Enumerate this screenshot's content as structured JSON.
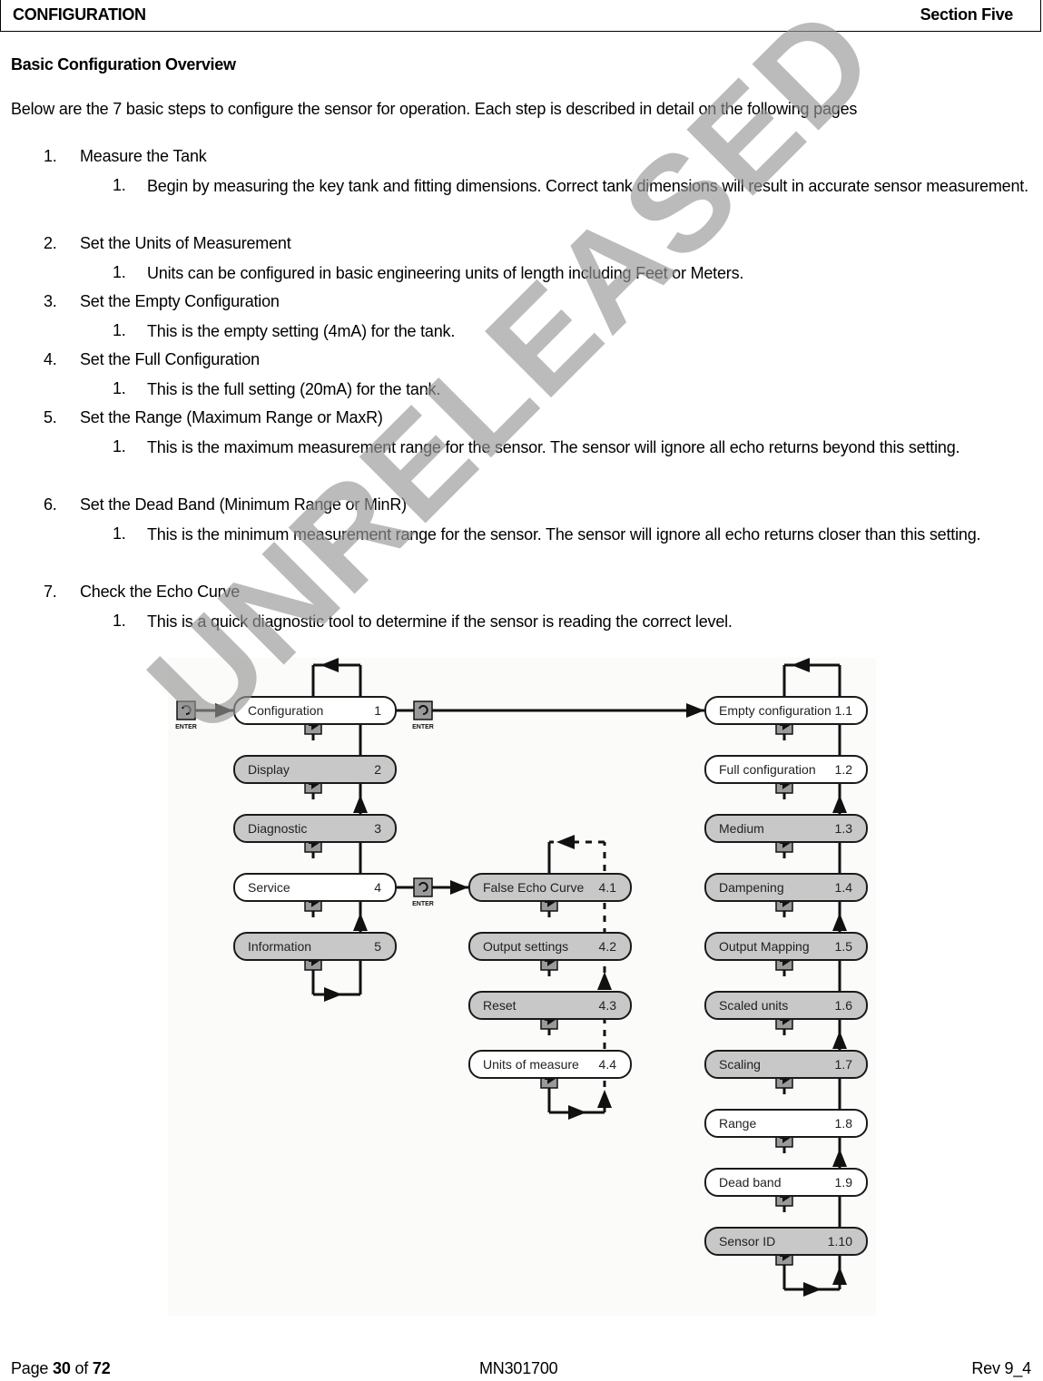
{
  "header": {
    "section_name": "CONFIGURATION",
    "section_number": "Section Five"
  },
  "title": "Basic Configuration Overview",
  "intro": "Below are the 7 basic steps to configure the sensor for operation.  Each step is described in detail on the following pages",
  "steps": [
    {
      "num": "1.",
      "label": "Measure the Tank",
      "sub": [
        {
          "num": "1.",
          "text": "Begin by measuring the key tank and fitting dimensions.  Correct tank dimensions will result in accurate sensor measurement."
        }
      ]
    },
    {
      "num": "2.",
      "label": "Set the Units of Measurement",
      "sub": [
        {
          "num": "1.",
          "text": "Units can be configured in basic engineering units of length including Feet or Meters."
        }
      ]
    },
    {
      "num": "3.",
      "label": "Set the Empty Configuration",
      "sub": [
        {
          "num": "1.",
          "text": "This is the empty setting (4mA) for the tank."
        }
      ]
    },
    {
      "num": "4.",
      "label": "Set the Full Configuration",
      "sub": [
        {
          "num": "1.",
          "text": "This is the full setting (20mA) for the tank."
        }
      ]
    },
    {
      "num": "5.",
      "label": "Set the Range (Maximum Range or MaxR)",
      "sub": [
        {
          "num": "1.",
          "text": "This is the maximum measurement range for the sensor.  The sensor will ignore all echo returns beyond this setting."
        }
      ]
    },
    {
      "num": "6.",
      "label": "Set the Dead Band (Minimum Range or MinR)",
      "sub": [
        {
          "num": "1.",
          "text": "This is the minimum measurement range for the sensor.  The sensor will ignore all echo returns closer than this setting."
        }
      ]
    },
    {
      "num": "7.",
      "label": "Check the Echo Curve",
      "sub": [
        {
          "num": "1.",
          "text": "This is a quick diagnostic tool to determine if the sensor is reading the correct level."
        }
      ]
    }
  ],
  "diagram": {
    "enter_label": "ENTER",
    "main_menu": [
      {
        "label": "Configuration",
        "index": "1",
        "style": "light"
      },
      {
        "label": "Display",
        "index": "2",
        "style": "dark"
      },
      {
        "label": "Diagnostic",
        "index": "3",
        "style": "dark"
      },
      {
        "label": "Service",
        "index": "4",
        "style": "light"
      },
      {
        "label": "Information",
        "index": "5",
        "style": "dark"
      }
    ],
    "service_menu": [
      {
        "label": "False Echo Curve",
        "index": "4.1",
        "style": "dark"
      },
      {
        "label": "Output settings",
        "index": "4.2",
        "style": "dark"
      },
      {
        "label": "Reset",
        "index": "4.3",
        "style": "dark"
      },
      {
        "label": "Units of measure",
        "index": "4.4",
        "style": "light"
      }
    ],
    "config_menu": [
      {
        "label": "Empty configuration",
        "index": "1.1",
        "style": "light"
      },
      {
        "label": "Full configuration",
        "index": "1.2",
        "style": "light"
      },
      {
        "label": "Medium",
        "index": "1.3",
        "style": "dark"
      },
      {
        "label": "Dampening",
        "index": "1.4",
        "style": "dark"
      },
      {
        "label": "Output Mapping",
        "index": "1.5",
        "style": "dark"
      },
      {
        "label": "Scaled units",
        "index": "1.6",
        "style": "dark"
      },
      {
        "label": "Scaling",
        "index": "1.7",
        "style": "dark"
      },
      {
        "label": "Range",
        "index": "1.8",
        "style": "light"
      },
      {
        "label": "Dead band",
        "index": "1.9",
        "style": "light"
      },
      {
        "label": "Sensor ID",
        "index": "1.10",
        "style": "dark"
      }
    ]
  },
  "watermark": "UNRELEASED",
  "footer": {
    "page_prefix": "Page ",
    "page": "30",
    "page_of": " of ",
    "total": "72",
    "doc_id": "MN301700",
    "revision": "Rev 9_4"
  }
}
